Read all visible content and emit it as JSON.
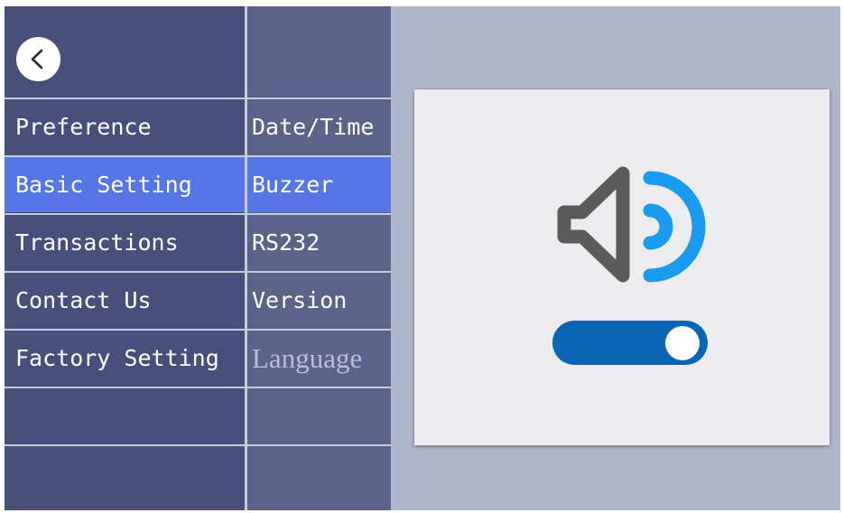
{
  "menu": {
    "items": [
      {
        "label": "Preference"
      },
      {
        "label": "Basic Setting",
        "selected": true
      },
      {
        "label": "Transactions"
      },
      {
        "label": "Contact Us"
      },
      {
        "label": "Factory Setting"
      }
    ]
  },
  "submenu": {
    "items": [
      {
        "label": "Date/Time"
      },
      {
        "label": "Buzzer",
        "selected": true
      },
      {
        "label": "RS232"
      },
      {
        "label": "Version"
      },
      {
        "label": "Language"
      }
    ]
  },
  "buzzer": {
    "icon": "speaker-sound-icon",
    "enabled": true
  },
  "colors": {
    "menu_bg": "#474f7a",
    "submenu_bg": "#5c6389",
    "selected": "#5676e6",
    "accent_blue": "#1a9bf0",
    "toggle_on": "#0a66b4",
    "speaker_gray": "#5b5b5b"
  }
}
